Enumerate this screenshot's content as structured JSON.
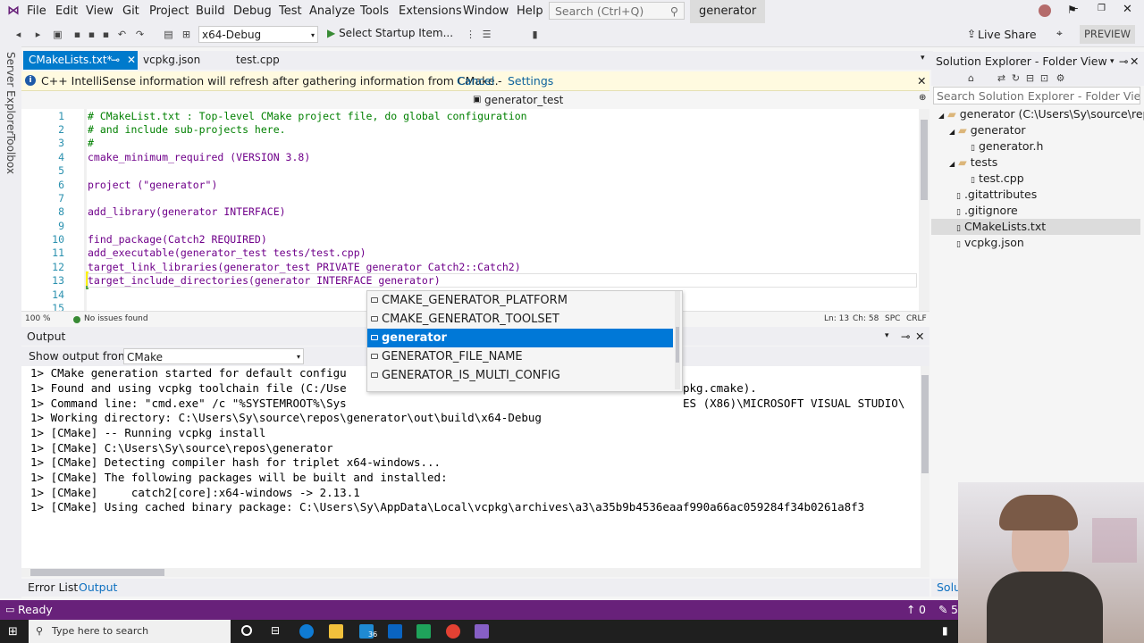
{
  "menubar": {
    "items": [
      "File",
      "Edit",
      "View",
      "Git",
      "Project",
      "Build",
      "Debug",
      "Test",
      "Analyze",
      "Tools",
      "Extensions",
      "Window",
      "Help"
    ],
    "search_placeholder": "Search (Ctrl+Q)",
    "solution_name": "generator"
  },
  "toolbar": {
    "config": "x64-Debug",
    "startup": "Select Startup Item...",
    "live_share": "Live Share",
    "preview": "PREVIEW"
  },
  "leftstrip": {
    "server_explorer": "Server Explorer",
    "toolbox": "Toolbox"
  },
  "tabs": [
    {
      "label": "CMakeLists.txt*",
      "active": true
    },
    {
      "label": "vcpkg.json",
      "active": false
    },
    {
      "label": "test.cpp",
      "active": false
    }
  ],
  "infobar": {
    "message": "C++ IntelliSense information will refresh after gathering information from CMake.",
    "cancel": "Cancel",
    "separator": "-",
    "settings": "Settings"
  },
  "navbar": {
    "target": "generator_test"
  },
  "editor": {
    "lines": [
      {
        "n": "1",
        "text": "# CMakeList.txt : Top-level CMake project file, do global configuration"
      },
      {
        "n": "2",
        "text": "# and include sub-projects here."
      },
      {
        "n": "3",
        "text": "#"
      },
      {
        "n": "4",
        "text": "cmake_minimum_required (VERSION 3.8)"
      },
      {
        "n": "5",
        "text": ""
      },
      {
        "n": "6",
        "text": "project (\"generator\")"
      },
      {
        "n": "7",
        "text": ""
      },
      {
        "n": "8",
        "text": "add_library(generator INTERFACE)"
      },
      {
        "n": "9",
        "text": ""
      },
      {
        "n": "10",
        "text": "find_package(Catch2 REQUIRED)"
      },
      {
        "n": "11",
        "text": "add_executable(generator_test tests/test.cpp)"
      },
      {
        "n": "12",
        "text": "target_link_libraries(generator_test PRIVATE generator Catch2::Catch2)"
      },
      {
        "n": "13",
        "text": "target_include_directories(generator INTERFACE generator)"
      },
      {
        "n": "14",
        "text": ""
      },
      {
        "n": "15",
        "text": ""
      }
    ],
    "status": {
      "zoom": "100 %",
      "issues": "No issues found",
      "line": "Ln: 13",
      "char": "Ch: 58",
      "spc": "SPC",
      "crlf": "CRLF"
    }
  },
  "autocomplete": {
    "items": [
      {
        "label": "CMAKE_GENERATOR_PLATFORM",
        "selected": false
      },
      {
        "label": "CMAKE_GENERATOR_TOOLSET",
        "selected": false
      },
      {
        "label": "generator",
        "selected": true
      },
      {
        "label": "GENERATOR_FILE_NAME",
        "selected": false
      },
      {
        "label": "GENERATOR_IS_MULTI_CONFIG",
        "selected": false
      }
    ]
  },
  "output": {
    "title": "Output",
    "show_from_label": "Show output from:",
    "source": "CMake",
    "lines": [
      "1> CMake generation started for default configu",
      "1> Found and using vcpkg toolchain file (C:/Use",
      "1> Command line: \"cmd.exe\" /c \"%SYSTEMROOT%\\Sys",
      "1> Working directory: C:\\Users\\Sy\\source\\repos\\generator\\out\\build\\x64-Debug",
      "1> [CMake] -- Running vcpkg install",
      "1> [CMake] C:\\Users\\Sy\\source\\repos\\generator",
      "1> [CMake] Detecting compiler hash for triplet x64-windows...",
      "1> [CMake] The following packages will be built and installed:",
      "1> [CMake]     catch2[core]:x64-windows -> 2.13.1",
      "1> [CMake] Using cached binary package: C:\\Users\\Sy\\AppData\\Local\\vcpkg\\archives\\a3\\a35b9b4536eaaf990a66ac059284f34b0261a8f3"
    ],
    "tail_line2": "pkg.cmake).",
    "tail_line3": "ES (X86)\\MICROSOFT VISUAL STUDIO\\"
  },
  "bottom_tabs": [
    "Error List",
    "Output"
  ],
  "solution_explorer": {
    "title": "Solution Explorer - Folder View",
    "search_placeholder": "Search Solution Explorer - Folder View",
    "items": [
      {
        "label": "generator (C:\\Users\\Sy\\source\\repos",
        "indent": 0,
        "kind": "folder-open"
      },
      {
        "label": "generator",
        "indent": 1,
        "kind": "folder"
      },
      {
        "label": "generator.h",
        "indent": 2,
        "kind": "file"
      },
      {
        "label": "tests",
        "indent": 1,
        "kind": "folder"
      },
      {
        "label": "test.cpp",
        "indent": 2,
        "kind": "file"
      },
      {
        "label": ".gitattributes",
        "indent": 1,
        "kind": "file"
      },
      {
        "label": ".gitignore",
        "indent": 1,
        "kind": "file"
      },
      {
        "label": "CMakeLists.txt",
        "indent": 1,
        "kind": "file",
        "selected": true
      },
      {
        "label": "vcpkg.json",
        "indent": 1,
        "kind": "file"
      }
    ],
    "bottom_tab": "Solu"
  },
  "statusbar": {
    "text": "Ready",
    "up_count": "0",
    "edit_count": "5"
  },
  "taskbar": {
    "search_placeholder": "Type here to search",
    "badge": "36"
  },
  "colors": {
    "accent": "#007acc",
    "status": "#68217a",
    "selection": "#0078d7"
  }
}
